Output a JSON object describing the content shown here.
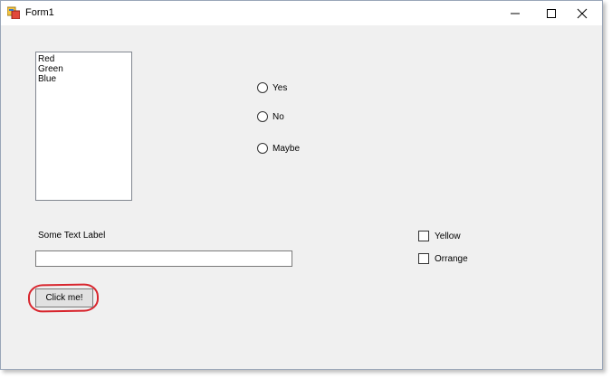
{
  "window": {
    "title": "Form1",
    "icons": {
      "app": "app-icon",
      "minimize": "minimize-icon",
      "maximize": "maximize-icon",
      "close": "close-icon"
    }
  },
  "listbox": {
    "items": [
      "Red",
      "Green",
      "Blue"
    ]
  },
  "radios": [
    {
      "label": "Yes"
    },
    {
      "label": "No"
    },
    {
      "label": "Maybe"
    }
  ],
  "label": {
    "text": "Some Text Label"
  },
  "textbox": {
    "value": ""
  },
  "checkboxes": [
    {
      "label": "Yellow",
      "checked": false
    },
    {
      "label": "Orrange",
      "checked": false
    }
  ],
  "button": {
    "label": "Click me!"
  },
  "colors": {
    "highlight": "#d8262e",
    "form_bg": "#f0f0f0"
  }
}
